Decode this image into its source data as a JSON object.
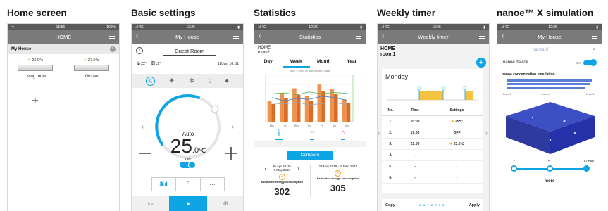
{
  "screens": [
    {
      "title": "Home screen"
    },
    {
      "title": "Basic settings"
    },
    {
      "title": "Statistics"
    },
    {
      "title": "Weekly timer"
    },
    {
      "title": "nanoe™ X simulation"
    }
  ],
  "home": {
    "time": "15:56",
    "battery": "100%",
    "appbar_title": "HOME",
    "section": "My House",
    "units": [
      {
        "temp": "25.0°c",
        "name": "Living room"
      },
      {
        "temp": "27.0°c",
        "name": "Kitchen"
      }
    ],
    "add": "+"
  },
  "basic": {
    "signal": ".ıl 4G",
    "time": "12:26",
    "appbar_title": "My House",
    "room": "Guest Room",
    "indoor_temp": "22°",
    "outdoor_temp": "12°",
    "datetime": "18Jan 16:51",
    "mode_icons": [
      "auto-icon",
      "sun-icon",
      "snowflake-icon",
      "drop-icon",
      "fan-icon"
    ],
    "mode_label": "Auto",
    "setpoint_int": "25",
    "setpoint_dec": ".0",
    "unit": "℃",
    "power_label": "ON",
    "minus": "−",
    "plus": "+",
    "more": "···"
  },
  "stats": {
    "signal": ".ıl 4G",
    "time": "12:26",
    "appbar_title": "Statistics",
    "loc1": "HOME",
    "loc2": "room2",
    "tabs": [
      "Day",
      "Week",
      "Month",
      "Year"
    ],
    "active_tab": "Week",
    "note": "Note : This is an approximated value",
    "compare_label": "Compare",
    "range1": "30.Apr.2018 - 6.May.2018",
    "range2": "28.May.2018 - 3.June.2018",
    "energy_label": "Estimated energy consumption",
    "value1": "302",
    "value2": "305"
  },
  "chart_data": {
    "type": "bar",
    "categories": [
      "Mon",
      "Tue",
      "Wed",
      "Thu",
      "Fri",
      "Sat",
      "Sun"
    ],
    "series": [
      {
        "values": [
          45,
          62,
          72,
          55,
          80,
          70,
          48
        ]
      },
      {
        "values": [
          38,
          50,
          58,
          45,
          66,
          60,
          40
        ]
      }
    ],
    "ylim": [
      0,
      100
    ]
  },
  "weekly": {
    "signal": ".ıl 4G",
    "time": "12:26",
    "appbar_title": "Weekly timer",
    "loc1": "HOME",
    "loc2": "room1",
    "day": "Monday",
    "headers": [
      "No.",
      "Time",
      "Settings"
    ],
    "rows": [
      {
        "no": "1.",
        "time": "10:00",
        "setting": "25℃",
        "icon": "sun"
      },
      {
        "no": "2.",
        "time": "17:00",
        "setting": "OFF",
        "icon": ""
      },
      {
        "no": "3.",
        "time": "21:00",
        "setting": "23.0℃",
        "icon": "sun"
      },
      {
        "no": "4.",
        "time": "-",
        "setting": "-",
        "icon": ""
      },
      {
        "no": "5.",
        "time": "-",
        "setting": "-",
        "icon": ""
      },
      {
        "no": "6.",
        "time": "-",
        "setting": "-",
        "icon": ""
      }
    ],
    "copy": "Copy",
    "apply": "Apply",
    "days": "S M T W T F S"
  },
  "nanoe": {
    "signal": ".ıl 4G",
    "time": "12:26",
    "appbar_title": "My House",
    "logo": "nanoe X",
    "device_label": "nanoe device",
    "toggle_label": "ON",
    "sim_title": "nanoe concentration simulation",
    "levels": [
      "Level 1",
      "Level 2",
      "Level 3"
    ],
    "slider_ticks": [
      "2",
      "5",
      "12"
    ],
    "slider_unit": "min.",
    "more": "more"
  },
  "colors": {
    "accent": "#0ea5e4",
    "orange": "#f39c12",
    "gray_bar": "#7a7a7a"
  }
}
